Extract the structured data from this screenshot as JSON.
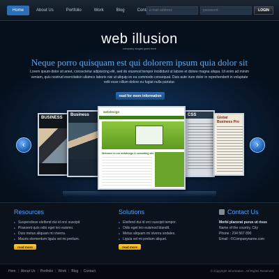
{
  "nav": {
    "items": [
      "Home",
      "About Us",
      "Portfolio",
      "Work",
      "Blog",
      "Contact"
    ]
  },
  "login": {
    "email_placeholder": "e-mail address",
    "password_placeholder": "password",
    "button": "LOGIN"
  },
  "hero": {
    "brand": "web illusion",
    "slogan": "company slogan goes here",
    "headline": "Neque porro quisquam est qui dolorem ipsum quia dolor sit",
    "intro": "Lorem ipsum dolor sit amet, consectetur adipisicing elit, sed do eiusmod tempor incididunt ut labore et dolore magna aliqua. Ut enim ad minim veniam, quis nostrud exercitation ullamco laboris nisi ut aliquip ex ea commodo consequat. Duis aute irure dolor in reprehenderit in voluptate velit esse cillum dolore eu fugiat nulla pariatur.",
    "more_button": "read for more information"
  },
  "slider": {
    "prev_icon": "chevron-left-icon",
    "next_icon": "chevron-right-icon",
    "cards": [
      {
        "title": "BUSINESS"
      },
      {
        "title": "Business"
      },
      {
        "logo": "webdesign",
        "welcome": "Welcome to our webdesign & consulting site"
      },
      {
        "title": "CSS"
      },
      {
        "title": "Global Business Pro"
      }
    ]
  },
  "resources": {
    "title": "Resources",
    "items": [
      "Suspendisse eleifend dui id orci suscipit",
      "Praesent quis odio eget leo euismo.",
      "Duis metus aliquam mi viverra.",
      "Mauris elementum ligula vel mi pretium."
    ],
    "more": "read more"
  },
  "solutions": {
    "title": "Solutions",
    "items": [
      "Eleifend dui id orci suscipit tempor.",
      "Odio eget leo euismod blandit.",
      "Metus aliquam mi viverra sodales.",
      "Ligula vel mi pretium aliquet."
    ],
    "more": "read more"
  },
  "contact": {
    "title": "Contact Us",
    "line1": "Morbi placerat purus ut risus",
    "line2": "Name of the country, City",
    "phone": "Phone : 234 567 890",
    "email": "Email : ©Companyname.com"
  },
  "footer": {
    "links": [
      "Hom",
      "About Us",
      "Portfolio",
      "Work",
      "Blog",
      "Contact"
    ],
    "copyright": "© Copyright information . All Rights Reserved"
  },
  "colors": {
    "accent": "#2d6fb6",
    "heading_blue": "#4aa3ff",
    "button_orange": "#f5b027"
  }
}
